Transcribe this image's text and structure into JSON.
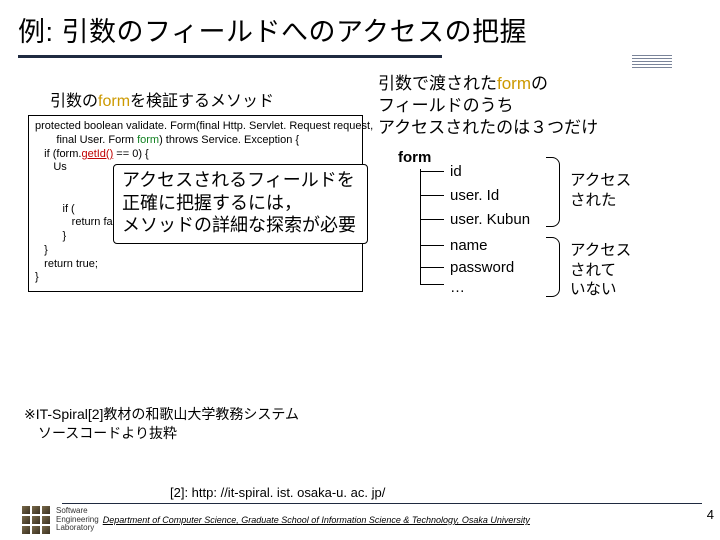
{
  "title": "例: 引数のフィールドへのアクセスの把握",
  "left_caption_pre": "引数の",
  "left_caption_kw": "form",
  "left_caption_post": "を検証するメソッド",
  "code": {
    "l1": "protected boolean validate. Form(final Http. Servlet. Request request,",
    "l2": "       final User. Form ",
    "l2_kw": "form",
    "l2_post": ") throws Service. Exception {",
    "l3": "",
    "l4": "   if (form.",
    "l4_red": "getId()",
    "l4_post": " == 0) {",
    "l5": "      Us",
    "l6": "",
    "l7": "         if (",
    "l8": "",
    "l9": "            return false;",
    "l10": "         }",
    "l11": "   }",
    "l12": "   return true;",
    "l13": "}"
  },
  "overlay": {
    "l1": "アクセスされるフィールドを",
    "l2": "正確に把握するには，",
    "l3": "メソッドの詳細な探索が必要"
  },
  "right_caption": {
    "l1_pre": "引数で渡された",
    "l1_kw": "form",
    "l1_post": "の",
    "l2": "フィールドのうち",
    "l3": "アクセスされたのは３つだけ"
  },
  "diagram": {
    "root": "form",
    "fields_accessed": [
      "id",
      "user. Id",
      "user. Kubun"
    ],
    "fields_not": [
      "name",
      "password",
      "…"
    ],
    "note_accessed_l1": "アクセス",
    "note_accessed_l2": "された",
    "note_not_l1": "アクセス",
    "note_not_l2": "されて",
    "note_not_l3": "いない"
  },
  "footnote": {
    "l1": "※IT-Spiral[2]教材の和歌山大学教務システム",
    "l2": "　ソースコードより抜粋"
  },
  "ref": "[2]: http: //it-spiral. ist. osaka-u. ac. jp/",
  "logo_text_l1": "Software",
  "logo_text_l2": "Engineering",
  "logo_text_l3": "Laboratory",
  "dept": "Department of Computer Science, Graduate School of Information Science & Technology, Osaka University",
  "pagenum": "4"
}
